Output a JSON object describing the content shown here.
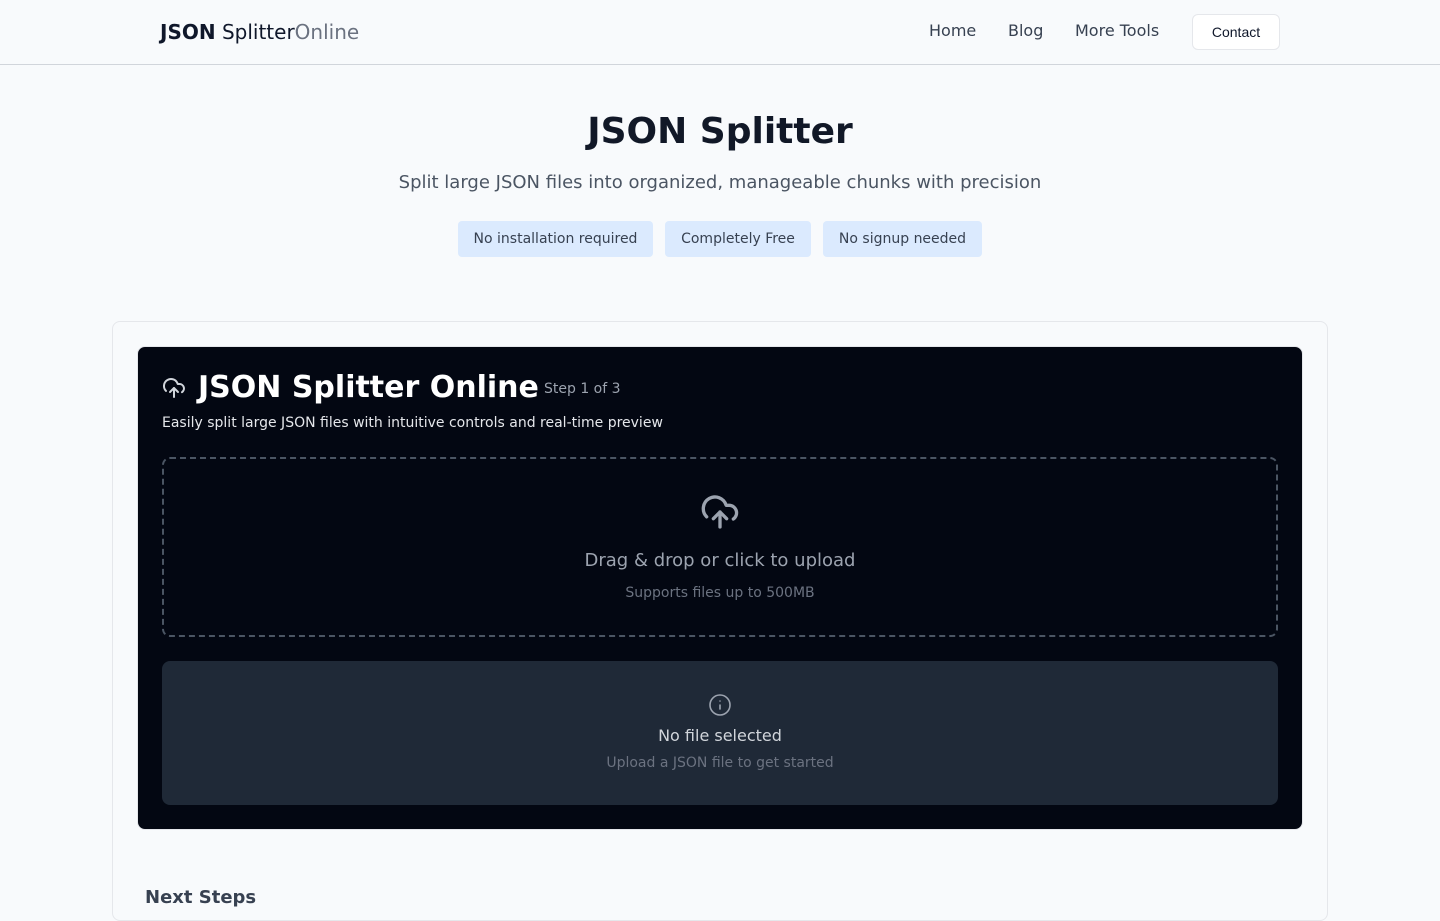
{
  "header": {
    "logo_bold": "JSON",
    "logo_main": "Splitter",
    "logo_light": "Online",
    "nav": [
      "Home",
      "Blog",
      "More Tools"
    ],
    "contact_label": "Contact"
  },
  "hero": {
    "title": "JSON Splitter",
    "subtitle": "Split large JSON files into organized, manageable chunks with precision",
    "badges": [
      "No installation required",
      "Completely Free",
      "No signup needed"
    ]
  },
  "panel": {
    "title": "JSON Splitter Online",
    "step": "Step 1 of 3",
    "description": "Easily split large JSON files with intuitive controls and real-time preview",
    "dropzone": {
      "text": "Drag & drop or click to upload",
      "subtext": "Supports files up to 500MB"
    },
    "status": {
      "title": "No file selected",
      "subtitle": "Upload a JSON file to get started"
    }
  },
  "next_steps": "Next Steps",
  "icons": {
    "panel": "cloud-upload-icon",
    "dropzone": "cloud-upload-icon",
    "status": "info-icon"
  },
  "colors": {
    "badge_bg": "#dbeafe",
    "panel_bg": "#030712",
    "status_bg": "#1f2937"
  }
}
